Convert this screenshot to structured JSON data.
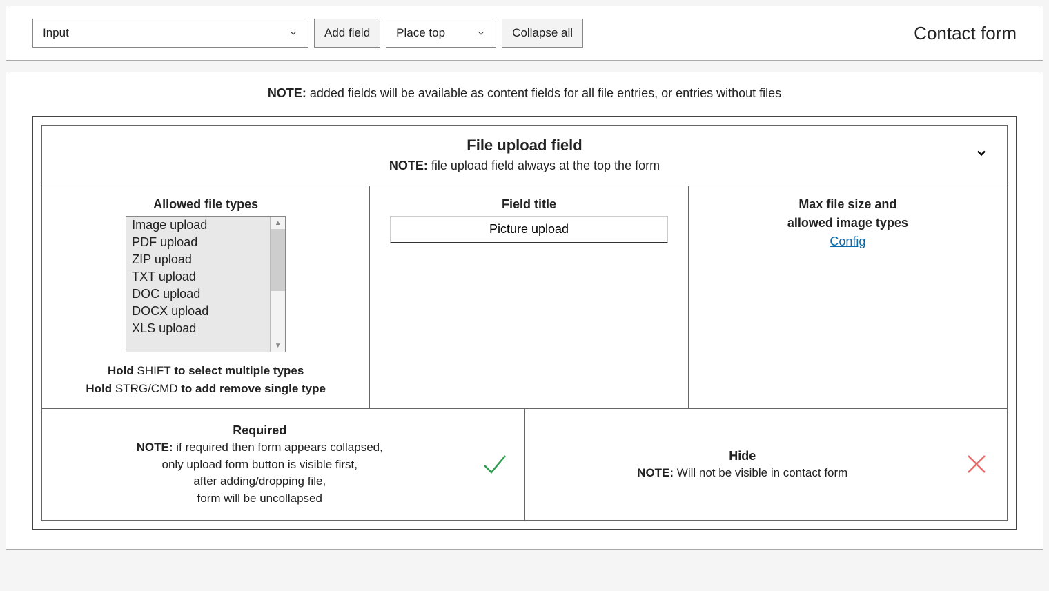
{
  "toolbar": {
    "field_type_selected": "Input",
    "add_field_label": "Add field",
    "place_selected": "Place top",
    "collapse_all_label": "Collapse all",
    "page_title": "Contact form"
  },
  "main_note": {
    "prefix": "NOTE:",
    "text": " added fields will be available as content fields for all file entries, or entries without files"
  },
  "card": {
    "title": "File upload field",
    "subnote_prefix": "NOTE:",
    "subnote_text": " file upload field always at the top the form",
    "allowed_types_label": "Allowed file types",
    "allowed_types": [
      "Image upload",
      "PDF upload",
      "ZIP upload",
      "TXT upload",
      "DOC upload",
      "DOCX upload",
      "XLS upload"
    ],
    "hint_line1_a": "Hold ",
    "hint_line1_b": "SHIFT",
    "hint_line1_c": " to select multiple types",
    "hint_line2_a": "Hold ",
    "hint_line2_b": "STRG/CMD",
    "hint_line2_c": " to add remove single type",
    "field_title_label": "Field title",
    "field_title_value": "Picture upload",
    "config_label1": "Max file size and",
    "config_label2": "allowed image types",
    "config_link": "Config",
    "required": {
      "title": "Required",
      "note_prefix": "NOTE:",
      "note_text": " if required then form appears collapsed,",
      "line2": "only upload form button is visible first,",
      "line3": "after adding/dropping file,",
      "line4": "form will be uncollapsed"
    },
    "hide": {
      "title": "Hide",
      "note_prefix": "NOTE:",
      "note_text": " Will not be visible in contact form"
    }
  }
}
